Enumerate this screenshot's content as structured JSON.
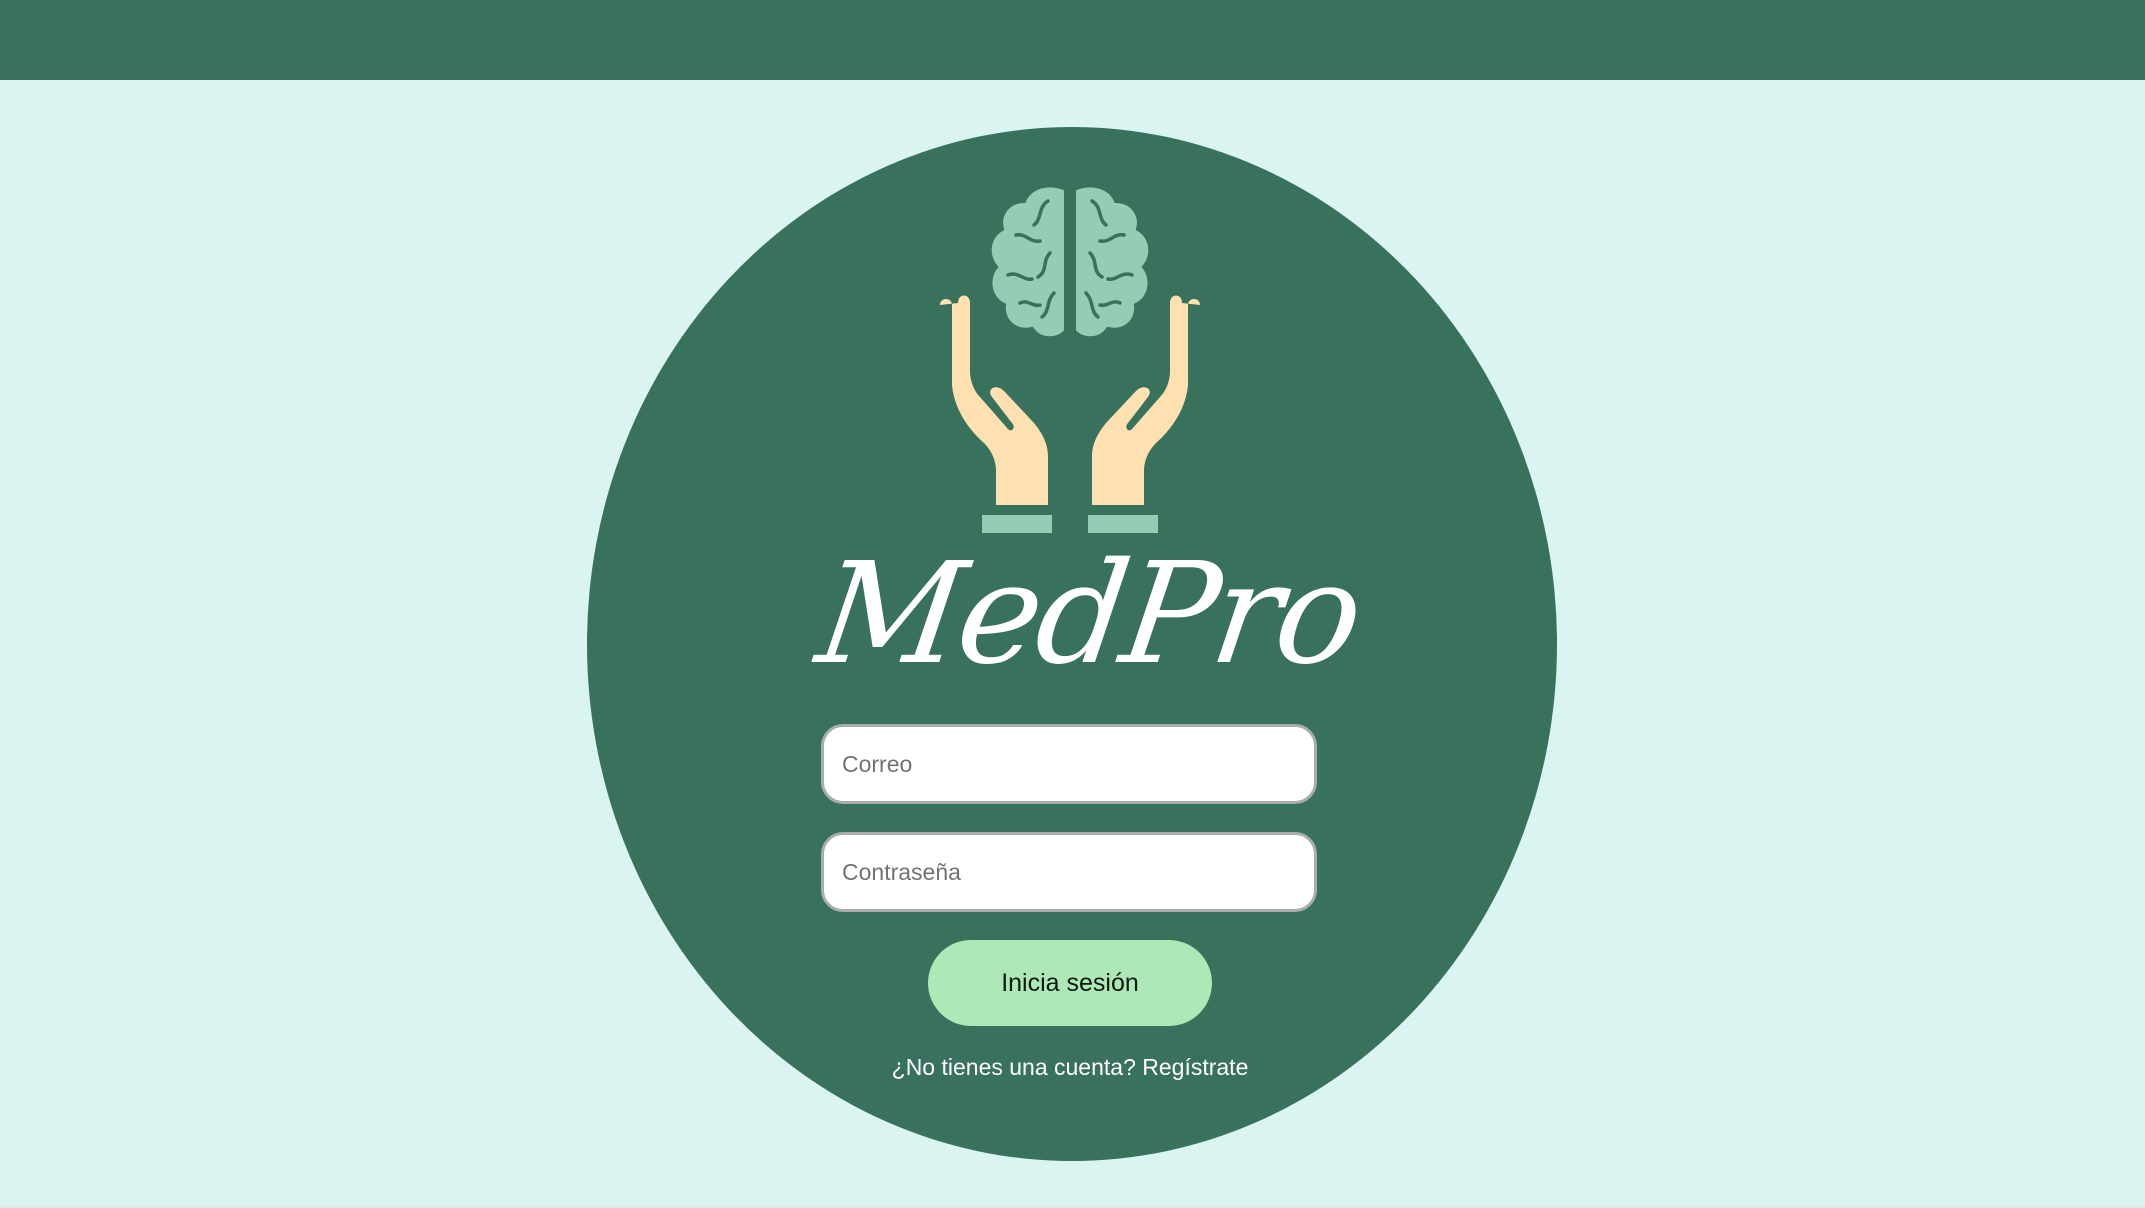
{
  "app": {
    "brand_name": "MedPro",
    "logo_icon": "brain-in-hands-icon"
  },
  "colors": {
    "header": "#38715c",
    "background": "#daf5f1",
    "card": "#38715c",
    "button": "#aee8b7",
    "brain": "#93cdb6",
    "hands": "#ffe0b0"
  },
  "login": {
    "email_placeholder": "Correo",
    "password_placeholder": "Contraseña",
    "submit_label": "Inicia sesión",
    "register_prompt": "¿No tienes una cuenta?",
    "register_link": "Regístrate"
  }
}
